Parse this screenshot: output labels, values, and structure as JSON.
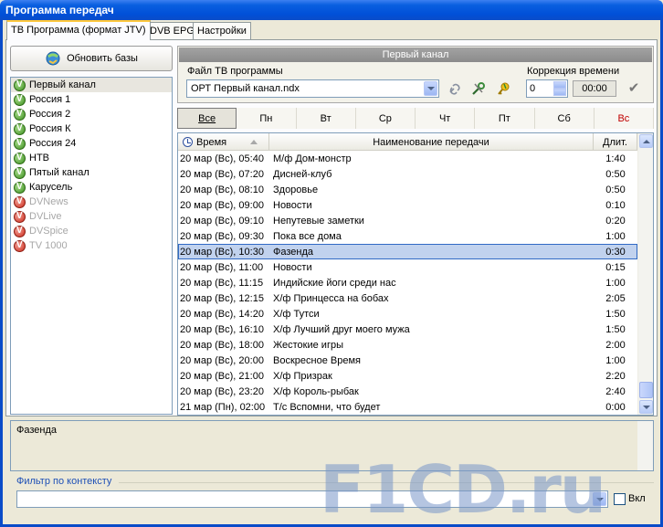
{
  "window": {
    "title": "Программа передач"
  },
  "tabs": [
    {
      "label": "ТВ Программа (формат JTV)",
      "active": true
    },
    {
      "label": "DVB EPG",
      "active": false
    },
    {
      "label": "Настройки",
      "active": false
    }
  ],
  "update_button": {
    "label": "Обновить базы",
    "icon": "refresh-globe-icon"
  },
  "channels": [
    {
      "label": "Первый канал",
      "enabled": true,
      "selected": true
    },
    {
      "label": "Россия 1",
      "enabled": true
    },
    {
      "label": "Россия 2",
      "enabled": true
    },
    {
      "label": "Россия К",
      "enabled": true
    },
    {
      "label": "Россия 24",
      "enabled": true
    },
    {
      "label": "НТВ",
      "enabled": true
    },
    {
      "label": "Пятый канал",
      "enabled": true
    },
    {
      "label": "Карусель",
      "enabled": true
    },
    {
      "label": "DVNews",
      "enabled": false
    },
    {
      "label": "DVLive",
      "enabled": false
    },
    {
      "label": "DVSpice",
      "enabled": false
    },
    {
      "label": "TV 1000",
      "enabled": false
    }
  ],
  "channel_panel": {
    "title": "Первый канал",
    "file_label": "Файл ТВ программы",
    "file_value": "ОРТ  Первый канал.ndx",
    "correction_label": "Коррекция времени",
    "correction_value": "0",
    "correction_time": "00:00"
  },
  "days": [
    "Все",
    "Пн",
    "Вт",
    "Ср",
    "Чт",
    "Пт",
    "Сб",
    "Вс"
  ],
  "grid": {
    "columns": {
      "time": "Время",
      "name": "Наименование передачи",
      "dur": "Длит."
    },
    "rows": [
      {
        "time": "20 мар (Вс), 05:40",
        "name": "М/ф Дом-монстр",
        "dur": "1:40"
      },
      {
        "time": "20 мар (Вс), 07:20",
        "name": "Дисней-клуб",
        "dur": "0:50"
      },
      {
        "time": "20 мар (Вс), 08:10",
        "name": "Здоровье",
        "dur": "0:50"
      },
      {
        "time": "20 мар (Вс), 09:00",
        "name": "Новости",
        "dur": "0:10"
      },
      {
        "time": "20 мар (Вс), 09:10",
        "name": "Непутевые заметки",
        "dur": "0:20"
      },
      {
        "time": "20 мар (Вс), 09:30",
        "name": "Пока все дома",
        "dur": "1:00"
      },
      {
        "time": "20 мар (Вс), 10:30",
        "name": "Фазенда",
        "dur": "0:30",
        "selected": true
      },
      {
        "time": "20 мар (Вс), 11:00",
        "name": "Новости",
        "dur": "0:15"
      },
      {
        "time": "20 мар (Вс), 11:15",
        "name": "Индийские йоги среди нас",
        "dur": "1:00"
      },
      {
        "time": "20 мар (Вс), 12:15",
        "name": "Х/ф Принцесса на бобах",
        "dur": "2:05"
      },
      {
        "time": "20 мар (Вс), 14:20",
        "name": "Х/ф Тутси",
        "dur": "1:50"
      },
      {
        "time": "20 мар (Вс), 16:10",
        "name": "Х/ф Лучший друг моего мужа",
        "dur": "1:50"
      },
      {
        "time": "20 мар (Вс), 18:00",
        "name": "Жестокие игры",
        "dur": "2:00"
      },
      {
        "time": "20 мар (Вс), 20:00",
        "name": "Воскресное Время",
        "dur": "1:00"
      },
      {
        "time": "20 мар (Вс), 21:00",
        "name": "Х/ф Призрак",
        "dur": "2:20"
      },
      {
        "time": "20 мар (Вс), 23:20",
        "name": "Х/ф Король-рыбак",
        "dur": "2:40"
      },
      {
        "time": "21 мар (Пн), 02:00",
        "name": "Т/с Вспомни, что будет",
        "dur": "0:00"
      }
    ]
  },
  "description": {
    "text": "Фазенда"
  },
  "filter": {
    "label": "Фильтр по контексту",
    "value": "",
    "checkbox_label": "Вкл"
  },
  "watermark": {
    "text": "F1CD.ru"
  }
}
